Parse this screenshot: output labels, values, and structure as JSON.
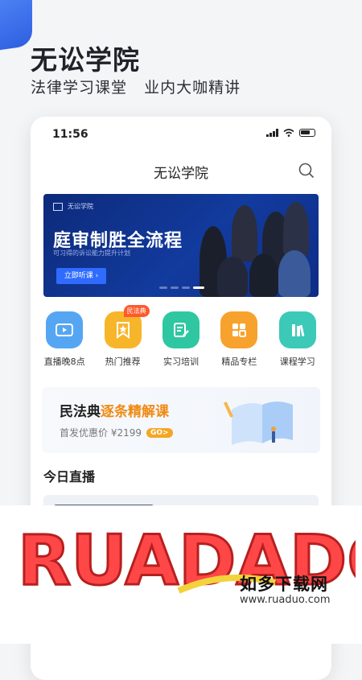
{
  "promo": {
    "title": "无讼学院",
    "subtitle": "法律学习课堂   业内大咖精讲"
  },
  "status_bar": {
    "time": "11:56"
  },
  "nav": {
    "title": "无讼学院"
  },
  "banner": {
    "logo_text": "无讼学院",
    "title": "庭审制胜全流程",
    "subtitle": "可习得的诉讼能力提升计划",
    "button_label": "立即听课 ›"
  },
  "categories": [
    {
      "label": "直播晚8点",
      "color": "#55a6f2",
      "icon": "tv-icon",
      "badge": ""
    },
    {
      "label": "热门推荐",
      "color": "#f7b52a",
      "icon": "star-bookmark-icon",
      "badge": "民法典"
    },
    {
      "label": "实习培训",
      "color": "#2fc7a1",
      "icon": "document-edit-icon",
      "badge": ""
    },
    {
      "label": "精品专栏",
      "color": "#f7a22c",
      "icon": "grid-icon",
      "badge": ""
    },
    {
      "label": "课程学习",
      "color": "#3cc9b8",
      "icon": "books-icon",
      "badge": ""
    }
  ],
  "promo_card": {
    "title_black": "民法典",
    "title_orange": "逐条精解课",
    "price_text": "首发优惠价 ¥2199",
    "go_label": "GO>"
  },
  "live": {
    "section_title": "今日直播"
  },
  "watermark": {
    "logo_text": "RUADADO",
    "cn": "如多下载网",
    "url": "www.ruaduo.com"
  },
  "colors": {
    "accent": "#2f6bff",
    "orange": "#f08a12",
    "banner_bg": "#123b9e"
  }
}
